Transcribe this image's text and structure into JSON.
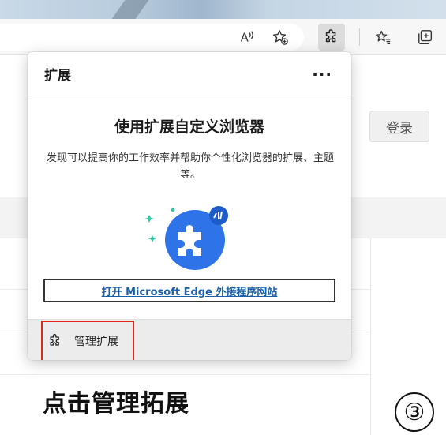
{
  "colors": {
    "highlight_box": "#e0251e",
    "link_blue": "#1a5fa8",
    "puzzle_blue": "#2e74e8",
    "sparkle_green": "#2ec4a0"
  },
  "toolbar": {
    "icons": [
      "read-aloud-icon",
      "add-favorite-icon",
      "extensions-icon",
      "favorites-icon",
      "collections-icon"
    ],
    "read_aloud_glyph": "A"
  },
  "page": {
    "login_label": "登录",
    "caption": "点击管理拓展",
    "step_number": "③"
  },
  "popup": {
    "title": "扩展",
    "more_label": "···",
    "heading": "使用扩展自定义浏览器",
    "description": "发现可以提高你的工作效率并帮助你个性化浏览器的扩展、主题等。",
    "open_link_label": "打开 Microsoft Edge 外接程序网站",
    "manage_label": "管理扩展"
  }
}
